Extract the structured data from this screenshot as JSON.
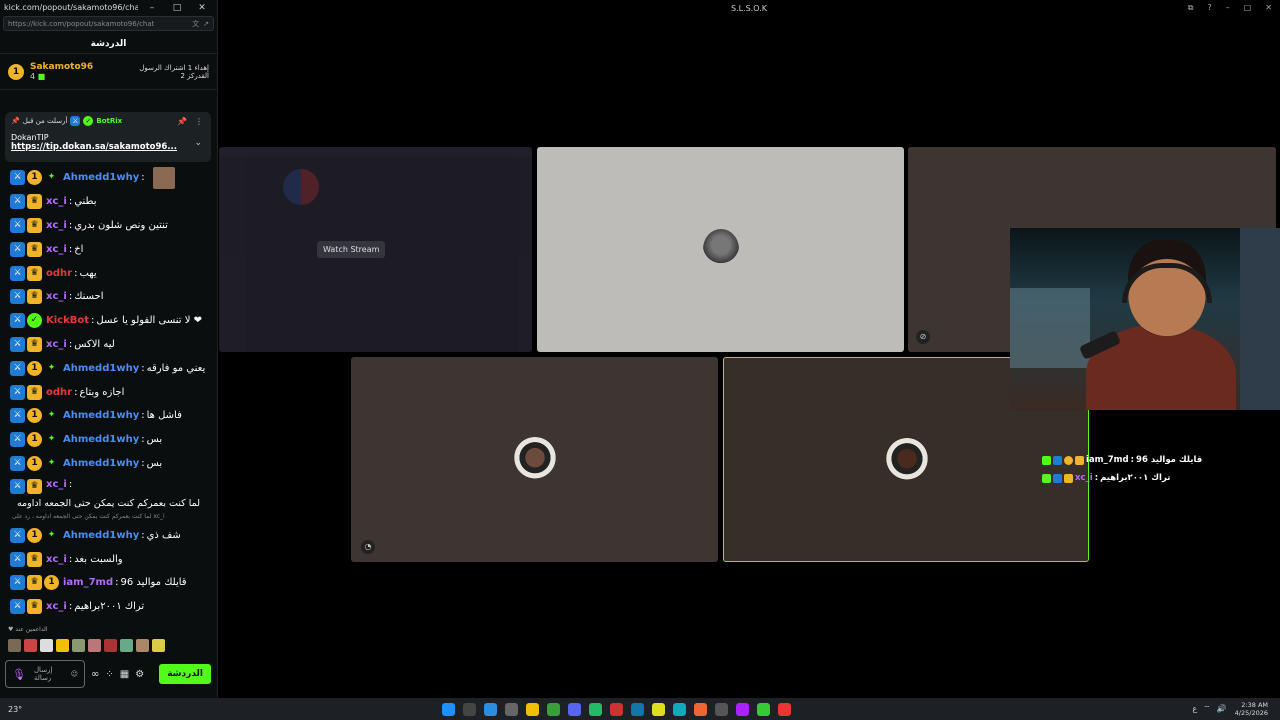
{
  "chat_window": {
    "title": "kick.com/popout/sakamoto96/chat - Profil...",
    "url": "https://kick.com/popout/sakamoto96/chat",
    "controls": [
      "–",
      "□",
      "✕"
    ],
    "header": "الدردشة",
    "leader": {
      "rank": "1",
      "name": "Sakamoto96",
      "count": "4",
      "gift_text": "إهداء 1 اشتراك الرسول القدركز 2"
    },
    "pinned": {
      "by_label": "أرسلت من قبل",
      "bot_name": "BotRix",
      "title": "DokanTIP",
      "link": "https://tip.dokan.sa/sakamoto96..."
    },
    "messages": [
      {
        "badges": [
          "mod",
          "num",
          "star"
        ],
        "user": "Ahmedd1why",
        "color": "#4d8cf0",
        "text": "",
        "avatar": true
      },
      {
        "badges": [
          "mod",
          "crown"
        ],
        "user": "xc_i",
        "color": "#b56bff",
        "text": "بطني"
      },
      {
        "badges": [
          "mod",
          "crown"
        ],
        "user": "xc_i",
        "color": "#b56bff",
        "text": "تنتين ونص شلون بدري"
      },
      {
        "badges": [
          "mod",
          "crown"
        ],
        "user": "xc_i",
        "color": "#b56bff",
        "text": "اخ"
      },
      {
        "badges": [
          "mod",
          "crown"
        ],
        "user": "odhr",
        "color": "#e23b3b",
        "text": "يهب"
      },
      {
        "badges": [
          "mod",
          "crown"
        ],
        "user": "xc_i",
        "color": "#b56bff",
        "text": "احسنك"
      },
      {
        "badges": [
          "mod",
          "verified"
        ],
        "user": "KickBot",
        "color": "#e23b3b",
        "text": "لا تنسى الفولو يا عسل ❤"
      },
      {
        "badges": [
          "mod",
          "crown"
        ],
        "user": "xc_i",
        "color": "#b56bff",
        "text": "ليه الاكس"
      },
      {
        "badges": [
          "mod",
          "num",
          "star"
        ],
        "user": "Ahmedd1why",
        "color": "#4d8cf0",
        "text": "يعني مو فارقه"
      },
      {
        "badges": [
          "mod",
          "crown"
        ],
        "user": "odhr",
        "color": "#e23b3b",
        "text": "اجازه وبتاع"
      },
      {
        "badges": [
          "mod",
          "num",
          "star"
        ],
        "user": "Ahmedd1why",
        "color": "#4d8cf0",
        "text": "فاشل ها"
      },
      {
        "badges": [
          "mod",
          "num",
          "star"
        ],
        "user": "Ahmedd1why",
        "color": "#4d8cf0",
        "text": "بس"
      },
      {
        "badges": [
          "mod",
          "num",
          "star"
        ],
        "user": "Ahmedd1why",
        "color": "#4d8cf0",
        "text": "بس"
      }
    ],
    "multi_message": {
      "badges": [
        "mod",
        "crown"
      ],
      "user": "xc_i",
      "color": "#b56bff",
      "text": "لما كنت بعمركم كنت يمكن حتى الجمعه اداومه"
    },
    "reply_note": "لما كنت بعمركم كنت يمكن حتى الجمعه اداومه ، رد على xc_i",
    "messages_after": [
      {
        "badges": [
          "mod",
          "num",
          "star"
        ],
        "user": "Ahmedd1why",
        "color": "#4d8cf0",
        "text": "شف ذي"
      },
      {
        "badges": [
          "mod",
          "crown"
        ],
        "user": "xc_i",
        "color": "#b56bff",
        "text": "والسبت بعد"
      },
      {
        "badges": [
          "mod",
          "crown",
          "num"
        ],
        "user": "iam_7md",
        "color": "#b56bff",
        "text": "قايلك مواليد 96"
      },
      {
        "badges": [
          "mod",
          "crown"
        ],
        "user": "xc_i",
        "color": "#b56bff",
        "text": "تراك ٢٠٠١براهيم"
      }
    ],
    "supporters_label": "الداعمين عند",
    "input_placeholder": "إرسال رسالة",
    "send_label": "الدردشة"
  },
  "stream": {
    "window_title": "S.L.S.O.K",
    "watch_label": "Watch Stream"
  },
  "overlay_chat": [
    {
      "user": "iam_7md",
      "text": "قايلك مواليد 96"
    },
    {
      "user": "xc_i",
      "text": "تراك ٢٠٠١براهيم"
    }
  ],
  "taskbar": {
    "temp": "23°",
    "time": "2:38 AM",
    "date": "4/25/2026",
    "lang": "ع"
  }
}
